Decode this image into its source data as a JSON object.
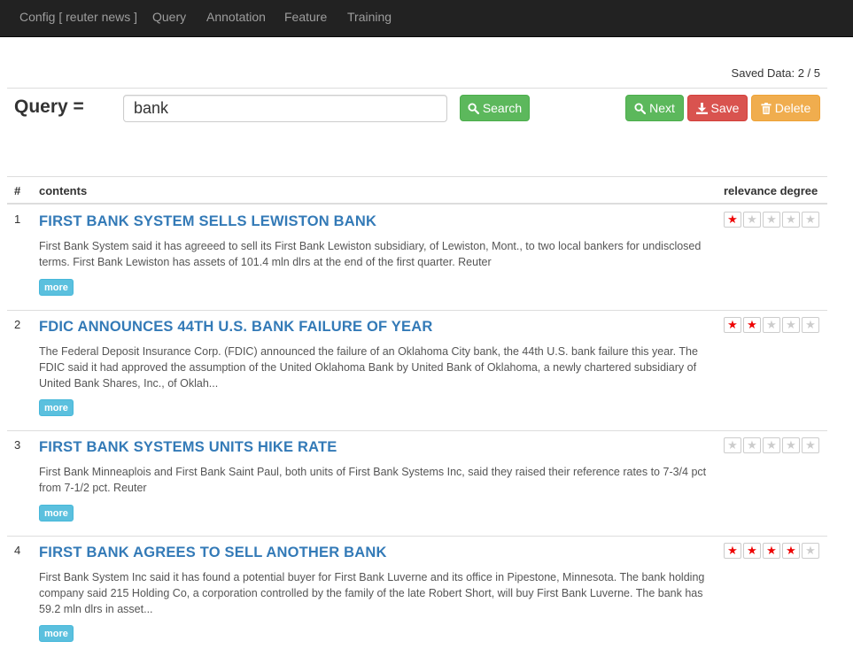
{
  "nav": {
    "items": [
      "Config [ reuter news ]",
      "Query",
      "Annotation",
      "Feature",
      "Training"
    ]
  },
  "status": {
    "saved_text": "Saved Data: 2 / 5"
  },
  "query": {
    "label": "Query =",
    "value": "bank",
    "search_label": "Search",
    "next_label": "Next",
    "save_label": "Save",
    "delete_label": "Delete"
  },
  "table": {
    "col_num": "#",
    "col_contents": "contents",
    "col_relevance": "relevance degree",
    "more_label": "more",
    "rows": [
      {
        "num": "1",
        "title": "FIRST BANK SYSTEM SELLS LEWISTON BANK",
        "body": "First Bank System said it has agreeed to sell its First Bank Lewiston subsidiary, of Lewiston, Mont., to two local bankers for undisclosed terms. First Bank Lewiston has assets of 101.4 mln dlrs at the end of the first quarter. Reuter",
        "rating": 1
      },
      {
        "num": "2",
        "title": "FDIC ANNOUNCES 44TH U.S. BANK FAILURE OF YEAR",
        "body": "The Federal Deposit Insurance Corp. (FDIC) announced the failure of an Oklahoma City bank, the 44th U.S. bank failure this year. The FDIC said it had approved the assumption of the United Oklahoma Bank by United Bank of Oklahoma, a newly chartered subsidiary of United Bank Shares, Inc., of Oklah...",
        "rating": 2
      },
      {
        "num": "3",
        "title": "FIRST BANK SYSTEMS UNITS HIKE RATE",
        "body": "First Bank Minneaplois and First Bank Saint Paul, both units of First Bank Systems Inc, said they raised their reference rates to 7-3/4 pct from 7-1/2 pct. Reuter",
        "rating": 0
      },
      {
        "num": "4",
        "title": "FIRST BANK AGREES TO SELL ANOTHER BANK",
        "body": "First Bank System Inc said it has found a potential buyer for First Bank Luverne and its office in Pipestone, Minnesota. The bank holding company said 215 Holding Co, a corporation controlled by the family of the late Robert Short, will buy First Bank Luverne. The bank has 59.2 mln dlrs in asset...",
        "rating": 4
      }
    ]
  },
  "colors": {
    "navbar_bg": "#222222",
    "link_blue": "#337ab7",
    "success": "#5cb85c",
    "danger": "#d9534f",
    "warning": "#f0ad4e",
    "info": "#5bc0de",
    "star_on": "#ee0000"
  }
}
